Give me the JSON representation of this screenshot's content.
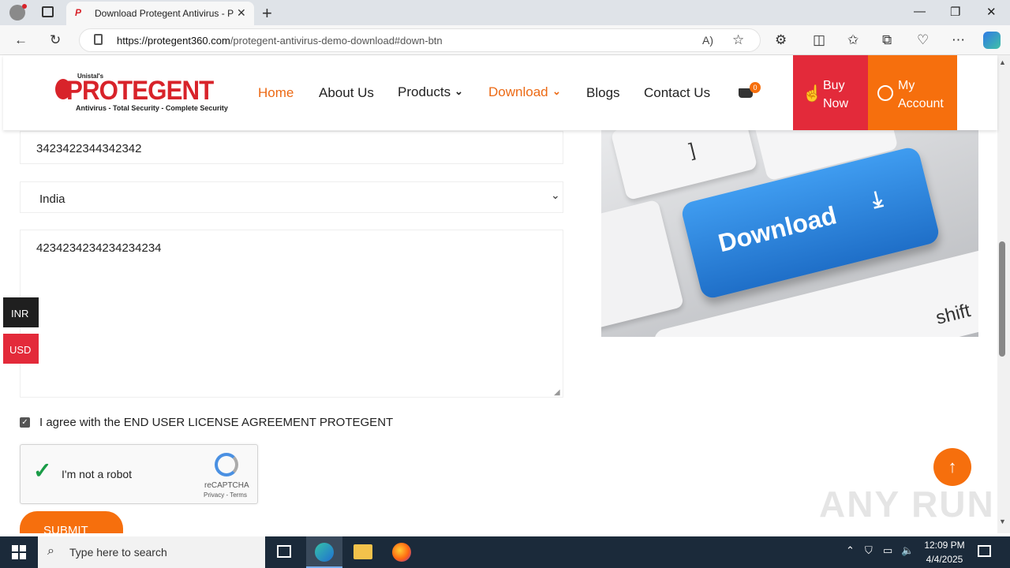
{
  "browser": {
    "tab_title": "Download Protegent Antivirus - P",
    "tab_favicon": "P",
    "url_domain": "https://protegent360.com",
    "url_path": "/protegent-antivirus-demo-download#down-btn",
    "read_aloud": "A)"
  },
  "site": {
    "logo_small": "Unistal's",
    "logo_big": "PROTEGENT",
    "logo_tagline": "Antivirus - Total Security - Complete Security",
    "nav": [
      "Home",
      "About Us",
      "Products",
      "Download",
      "Blogs",
      "Contact Us"
    ],
    "cart_count": "0",
    "buy_line1": "Buy",
    "buy_line2": "Now",
    "acct_line1": "My",
    "acct_line2": "Account"
  },
  "form": {
    "phone_value": "3423422344342342",
    "country_value": "India",
    "message_value": "4234234234234234234",
    "agree_label": "I agree with the END USER LICENSE AGREEMENT PROTEGENT",
    "captcha_label": "I'm not a robot",
    "captcha_brand": "reCAPTCHA",
    "captcha_links": "Privacy - Terms",
    "submit_label": "SUBMIT"
  },
  "currency": [
    "INR",
    "USD"
  ],
  "banner": {
    "key_word": "Download",
    "key_shift": "shift",
    "key_bracket": "]"
  },
  "taskbar": {
    "search_placeholder": "Type here to search",
    "time": "12:09 PM",
    "date": "4/4/2025"
  },
  "watermark": "ANY RUN",
  "colors": {
    "brand_red": "#d8232a",
    "orange": "#f66f0d",
    "buy_red": "#e32a3a",
    "nav_active": "#ec6a15"
  }
}
